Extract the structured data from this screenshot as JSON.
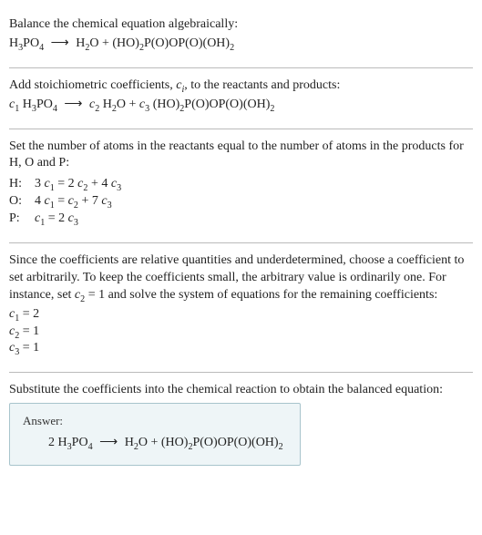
{
  "section1": {
    "intro": "Balance the chemical equation algebraically:",
    "lhs1": "H",
    "lhs1_sub": "3",
    "lhs2": "PO",
    "lhs2_sub": "4",
    "arrow": "⟶",
    "rhs1": "H",
    "rhs1_sub": "2",
    "rhs2": "O + (HO)",
    "rhs2_sub": "2",
    "rhs3": "P(O)OP(O)(OH)",
    "rhs3_sub": "2"
  },
  "section2": {
    "intro1": "Add stoichiometric coefficients, ",
    "ci": "c",
    "ci_sub": "i",
    "intro2": ", to the reactants and products:",
    "c1": "c",
    "c1_sub": "1",
    "sp": " ",
    "lhs1": "H",
    "lhs1_sub": "3",
    "lhs2": "PO",
    "lhs2_sub": "4",
    "arrow": "⟶",
    "c2": "c",
    "c2_sub": "2",
    "rhs1": "H",
    "rhs1_sub": "2",
    "rhs2": "O + ",
    "c3": "c",
    "c3_sub": "3",
    "rhs3": " (HO)",
    "rhs3_sub": "2",
    "rhs4": "P(O)OP(O)(OH)",
    "rhs4_sub": "2"
  },
  "section3": {
    "intro": "Set the number of atoms in the reactants equal to the number of atoms in the products for H, O and P:",
    "rows": {
      "h_label": "H:",
      "h_eq_a": "3 ",
      "h_eq_b": "c",
      "h_eq_bs": "1",
      "h_eq_c": " = 2 ",
      "h_eq_d": "c",
      "h_eq_ds": "2",
      "h_eq_e": " + 4 ",
      "h_eq_f": "c",
      "h_eq_fs": "3",
      "o_label": "O:",
      "o_eq_a": "4 ",
      "o_eq_b": "c",
      "o_eq_bs": "1",
      "o_eq_c": " = ",
      "o_eq_d": "c",
      "o_eq_ds": "2",
      "o_eq_e": " + 7 ",
      "o_eq_f": "c",
      "o_eq_fs": "3",
      "p_label": "P:",
      "p_eq_b": "c",
      "p_eq_bs": "1",
      "p_eq_c": " = 2 ",
      "p_eq_d": "c",
      "p_eq_ds": "3"
    }
  },
  "section4": {
    "intro1": "Since the coefficients are relative quantities and underdetermined, choose a coefficient to set arbitrarily. To keep the coefficients small, the arbitrary value is ordinarily one. For instance, set ",
    "c2": "c",
    "c2_sub": "2",
    "intro2": " = 1 and solve the system of equations for the remaining coefficients:",
    "l1a": "c",
    "l1as": "1",
    "l1b": " = 2",
    "l2a": "c",
    "l2as": "2",
    "l2b": " = 1",
    "l3a": "c",
    "l3as": "3",
    "l3b": " = 1"
  },
  "section5": {
    "intro": "Substitute the coefficients into the chemical reaction to obtain the balanced equation:",
    "answer_label": "Answer:",
    "eq": {
      "a": "2 H",
      "a_sub": "3",
      "b": "PO",
      "b_sub": "4",
      "arrow": "⟶",
      "c": "H",
      "c_sub": "2",
      "d": "O + (HO)",
      "d_sub": "2",
      "e": "P(O)OP(O)(OH)",
      "e_sub": "2"
    }
  },
  "chart_data": {
    "type": "table",
    "title": "Balanced chemical equation",
    "atom_balance": [
      {
        "element": "H",
        "lhs": "3 c1",
        "rhs": "2 c2 + 4 c3"
      },
      {
        "element": "O",
        "lhs": "4 c1",
        "rhs": "c2 + 7 c3"
      },
      {
        "element": "P",
        "lhs": "c1",
        "rhs": "2 c3"
      }
    ],
    "solution": {
      "c1": 2,
      "c2": 1,
      "c3": 1
    },
    "balanced_equation": "2 H3PO4 ⟶ H2O + (HO)2P(O)OP(O)(OH)2"
  }
}
